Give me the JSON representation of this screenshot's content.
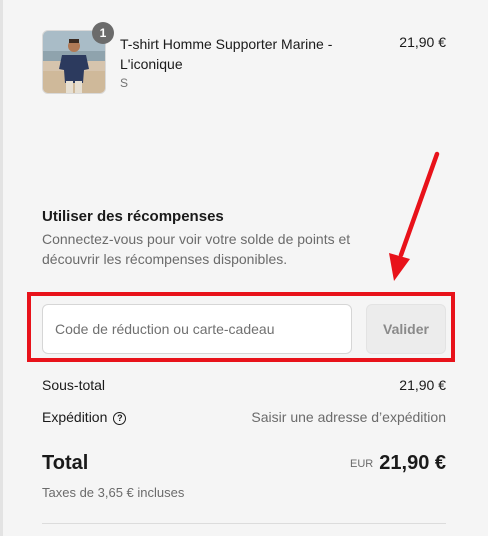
{
  "product": {
    "quantity": "1",
    "title": "T-shirt Homme Supporter Marine - L'iconique",
    "variant": "S",
    "price": "21,90 €"
  },
  "rewards": {
    "title": "Utiliser des récompenses",
    "description": "Connectez-vous pour voir votre solde de points et découvrir les récompenses disponibles."
  },
  "discount": {
    "placeholder": "Code de réduction ou carte-cadeau",
    "value": "",
    "button_label": "Valider"
  },
  "summary": {
    "subtotal_label": "Sous-total",
    "subtotal_value": "21,90 €",
    "shipping_label": "Expédition",
    "shipping_value": "Saisir une adresse d’expédition",
    "total_label": "Total",
    "currency": "EUR",
    "total_value": "21,90 €",
    "taxes_note": "Taxes de 3,65 € incluses"
  },
  "icons": {
    "help": "question-circle-icon",
    "annotation_arrow": "red-arrow-icon"
  },
  "colors": {
    "highlight": "#e8121a",
    "background": "#f5f5f5"
  }
}
